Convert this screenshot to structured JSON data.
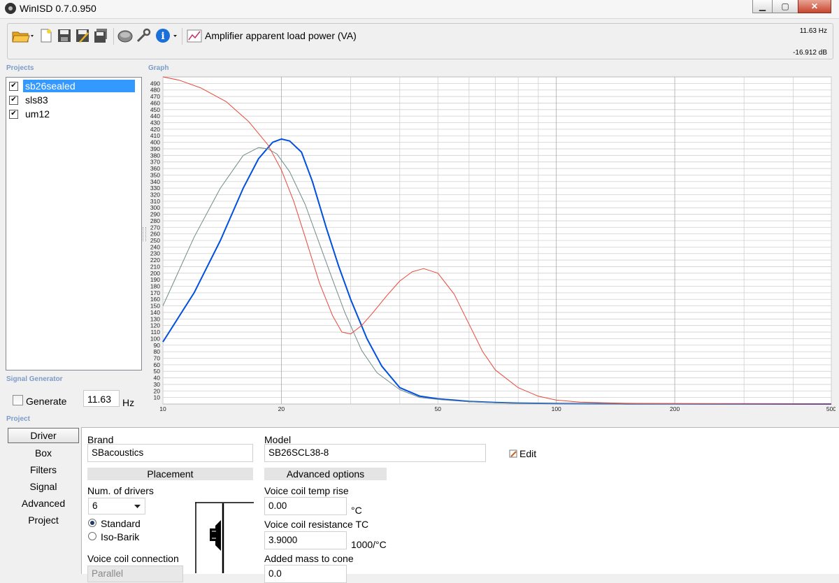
{
  "window": {
    "title": "WinISD 0.7.0.950",
    "btn_min": "▁",
    "btn_max": "▢",
    "btn_close": "✕"
  },
  "toolbar": {
    "icons": [
      "open-folder-icon",
      "new-file-icon",
      "save-icon",
      "save-as-icon",
      "save-all-icon",
      "driver-icon",
      "tools-icon",
      "info-icon",
      "graph-icon"
    ],
    "graph_title": "Amplifier apparent load power (VA)",
    "frequency_readout": "11.63 Hz",
    "db_readout": "-16.912 dB"
  },
  "sections": {
    "projects": "Projects",
    "graph": "Graph",
    "signal_generator": "Signal Generator",
    "project": "Project"
  },
  "projects": [
    {
      "name": "sb26sealed",
      "checked": true,
      "selected": true
    },
    {
      "name": "sls83",
      "checked": true,
      "selected": false
    },
    {
      "name": "um12",
      "checked": true,
      "selected": false
    }
  ],
  "signal_generator": {
    "generate_label": "Generate",
    "frequency": "11.63",
    "unit": "Hz"
  },
  "chart_data": {
    "type": "line",
    "title": "Amplifier apparent load power (VA)",
    "x_scale": "log",
    "xlim": [
      10,
      500
    ],
    "ylim": [
      0,
      500
    ],
    "x_ticks": [
      "10",
      "20",
      "50",
      "100",
      "200",
      "500"
    ],
    "y_ticks": [
      10,
      20,
      30,
      40,
      50,
      60,
      70,
      80,
      90,
      100,
      110,
      120,
      130,
      140,
      150,
      160,
      170,
      180,
      190,
      200,
      210,
      220,
      230,
      240,
      250,
      260,
      270,
      280,
      290,
      300,
      310,
      320,
      330,
      340,
      350,
      360,
      370,
      380,
      390,
      400,
      410,
      420,
      430,
      440,
      450,
      460,
      470,
      480,
      490
    ],
    "grid": true,
    "series": [
      {
        "color": "#0050e0",
        "width": 2,
        "x": [
          10,
          12,
          14,
          16,
          17.5,
          19,
          20,
          21,
          22.5,
          24,
          26,
          28,
          30,
          33,
          36,
          40,
          45,
          50,
          55,
          60,
          70,
          80,
          100,
          120,
          150,
          200,
          300,
          500
        ],
        "y": [
          95,
          170,
          250,
          330,
          375,
          400,
          405,
          402,
          385,
          340,
          270,
          210,
          160,
          100,
          58,
          25,
          12,
          8,
          6,
          4,
          2.5,
          1.5,
          0.8,
          0.5,
          0.3,
          0.2,
          0.1,
          0
        ]
      },
      {
        "color": "#708a8a",
        "width": 1,
        "x": [
          10,
          12,
          14,
          16,
          17.5,
          18.5,
          19.5,
          21,
          23,
          25,
          27,
          29,
          32,
          35,
          40,
          45,
          50,
          55,
          60,
          70,
          80,
          100,
          150,
          200,
          300,
          500
        ],
        "y": [
          150,
          255,
          330,
          380,
          392,
          390,
          382,
          355,
          305,
          245,
          190,
          140,
          82,
          48,
          22,
          10,
          7,
          5,
          3.5,
          2,
          1.2,
          0.6,
          0.2,
          0.1,
          0.05,
          0
        ]
      },
      {
        "color": "#e8483a",
        "width": 1,
        "x": [
          10,
          11,
          12.5,
          14.5,
          16.5,
          18.5,
          20,
          21.5,
          23,
          25,
          27,
          28.5,
          30,
          32,
          34,
          37,
          40,
          43,
          46,
          50,
          55,
          60,
          65,
          70,
          80,
          90,
          100,
          115,
          130,
          150,
          200,
          300,
          500
        ],
        "y": [
          500,
          495,
          483,
          462,
          432,
          396,
          358,
          310,
          255,
          185,
          135,
          110,
          107,
          120,
          138,
          165,
          188,
          202,
          207,
          200,
          168,
          122,
          80,
          52,
          25,
          12,
          6,
          3,
          2,
          1.2,
          0.5,
          0.2,
          0
        ]
      }
    ]
  },
  "tabs": [
    "Driver",
    "Box",
    "Filters",
    "Signal",
    "Advanced",
    "Project"
  ],
  "driver": {
    "brand_label": "Brand",
    "brand": "SBacoustics",
    "model_label": "Model",
    "model": "SB26SCL38-8",
    "edit_label": "Edit",
    "placement_header": "Placement",
    "num_drivers_label": "Num. of drivers",
    "num_drivers": "6",
    "radio_standard": "Standard",
    "radio_isobarik": "Iso-Barik",
    "voice_coil_connection_label": "Voice coil connection",
    "voice_coil_connection": "Parallel",
    "advanced_header": "Advanced options",
    "vc_temp_rise_label": "Voice coil temp rise",
    "vc_temp_rise": "0.00",
    "vc_temp_unit": "°C",
    "vc_resistance_tc_label": "Voice coil resistance TC",
    "vc_resistance_tc": "3.9000",
    "vc_resistance_tc_unit": "1000/°C",
    "added_mass_label": "Added mass to cone",
    "added_mass": "0.0"
  }
}
